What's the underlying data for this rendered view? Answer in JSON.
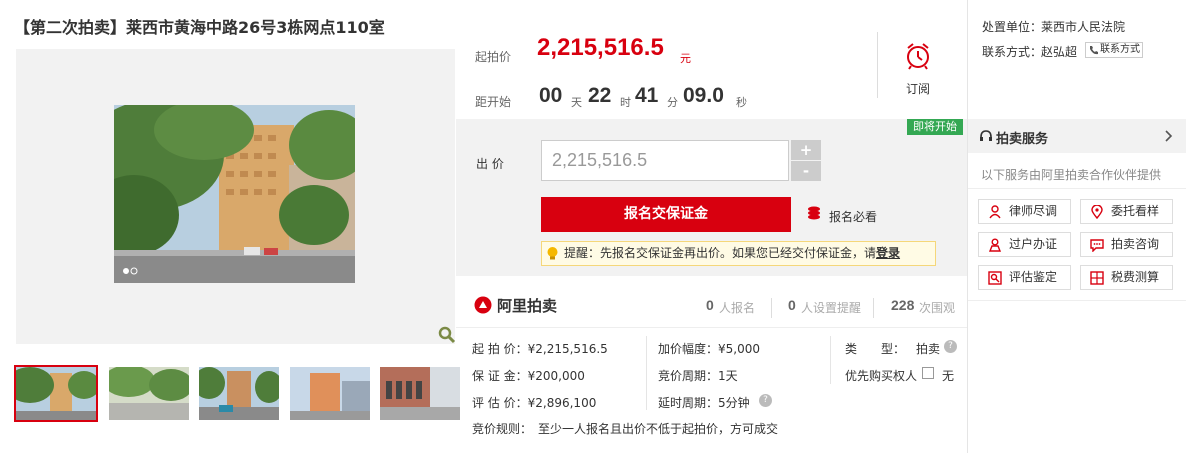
{
  "title": "【第二次拍卖】莱西市黄海中路26号3栋网点110室",
  "price": {
    "start_label": "起拍价",
    "start_value": "2,215,516.5",
    "currency": "元",
    "countdown_label": "距开始",
    "countdown": {
      "days": "00",
      "days_unit": "天",
      "hours": "22",
      "hours_unit": "时",
      "minutes": "41",
      "minutes_unit": "分",
      "seconds": "09.0",
      "seconds_unit": "秒"
    },
    "subscribe_label": "订阅"
  },
  "bid": {
    "badge": "即将开始",
    "label": "出 价",
    "input_value": "2,215,516.5",
    "plus": "+",
    "minus": "-",
    "deposit_button": "报名交保证金",
    "must_read": "报名必看",
    "tip_prefix": "提醒：先报名交保证金再出价。如果您已经交付保证金，请",
    "tip_login": "登录"
  },
  "stats": {
    "logo": "阿里拍卖",
    "signup_count": "0",
    "signup_label": "人报名",
    "remind_count": "0",
    "remind_label": "人设置提醒",
    "views_count": "228",
    "views_label": "次围观"
  },
  "details": {
    "start_price": "起 拍 价：¥2,215,516.5",
    "deposit": "保 证 金：¥200,000",
    "appraisal": "评 估 价：¥2,896,100",
    "increment": "加价幅度：¥5,000",
    "cycle": "竞价周期：1天",
    "delay": "延时周期：5分钟",
    "type_label": "类　　型：",
    "type_value": "拍卖",
    "priority_label": "优先购买权人",
    "priority_value": "无",
    "rules": "竞价规则：　至少一人报名且出价不低于起拍价，方可成交"
  },
  "sidebar": {
    "org_label": "处置单位：",
    "org_value": "莱西市人民法院",
    "contact_label": "联系方式：",
    "contact_value": "赵弘超",
    "contact_button": "联系方式",
    "service_title": "拍卖服务",
    "service_note": "以下服务由阿里拍卖合作伙伴提供",
    "services": [
      "律师尽调",
      "委托看样",
      "过户办证",
      "拍卖咨询",
      "评估鉴定",
      "税费测算"
    ]
  },
  "colors": {
    "accent": "#d8000f",
    "badge_green": "#34a853",
    "panel_gray": "#f2f2f2"
  }
}
